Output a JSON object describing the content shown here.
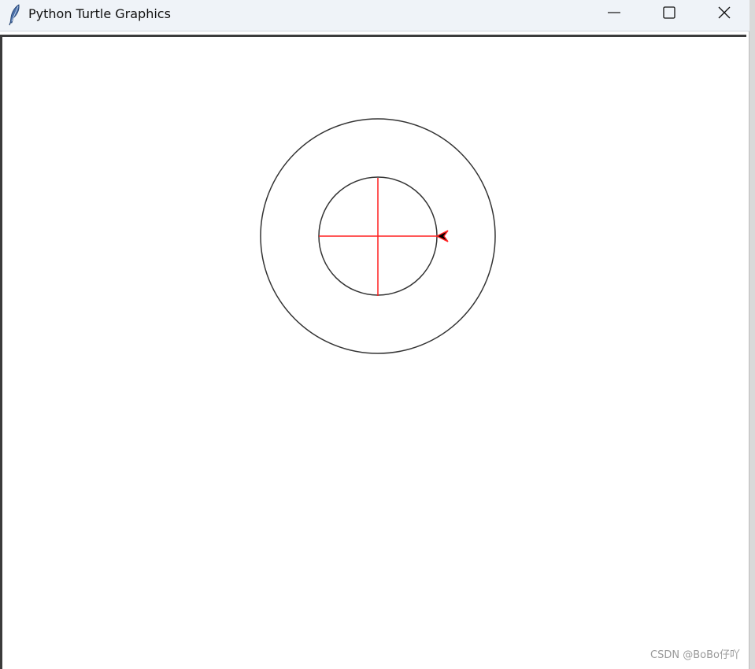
{
  "window": {
    "title": "Python Turtle Graphics",
    "icon": "feather-icon",
    "controls": {
      "minimize": "minimize-icon",
      "maximize": "maximize-icon",
      "close": "close-icon"
    }
  },
  "canvas": {
    "background": "#ffffff",
    "circle_color": "#333333",
    "cross_color": "#ff2020",
    "turtle_color": "#000000",
    "turtle_outline": "#ff2020"
  },
  "watermark": "CSDN @BoBo仔吖"
}
